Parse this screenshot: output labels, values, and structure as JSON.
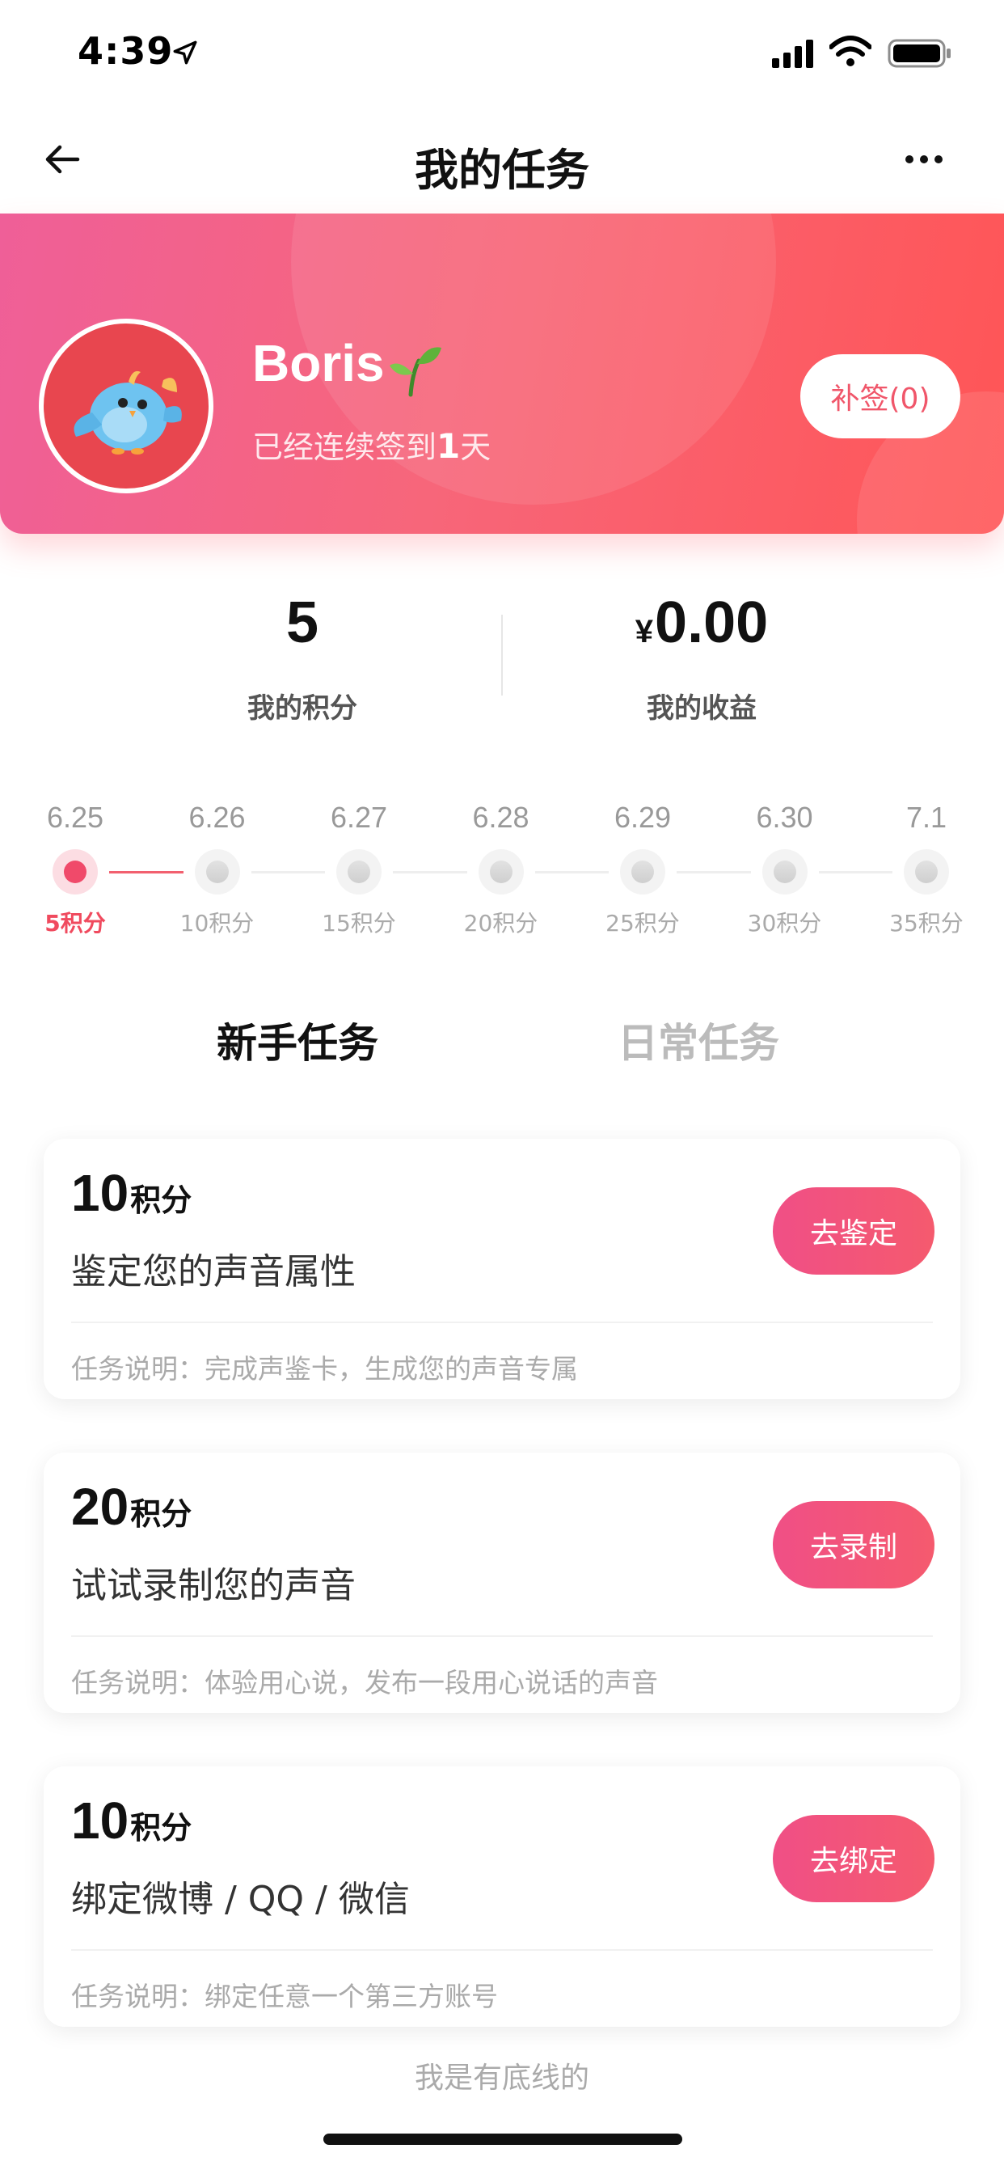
{
  "status_bar": {
    "time": "4:39"
  },
  "nav": {
    "title": "我的任务"
  },
  "profile": {
    "name": "Boris",
    "checkin_prefix": "已经连续签到",
    "checkin_days": "1",
    "checkin_suffix": "天",
    "makeup_label": "补签(0)"
  },
  "stats": {
    "points_value": "5",
    "points_label": "我的积分",
    "currency_symbol": "¥",
    "earnings_value": "0.00",
    "earnings_label": "我的收益"
  },
  "checkin_timeline": [
    {
      "date": "6.25",
      "points": "5积分",
      "active": true
    },
    {
      "date": "6.26",
      "points": "10积分",
      "active": false
    },
    {
      "date": "6.27",
      "points": "15积分",
      "active": false
    },
    {
      "date": "6.28",
      "points": "20积分",
      "active": false
    },
    {
      "date": "6.29",
      "points": "25积分",
      "active": false
    },
    {
      "date": "6.30",
      "points": "30积分",
      "active": false
    },
    {
      "date": "7.1",
      "points": "35积分",
      "active": false
    }
  ],
  "tabs": [
    {
      "label": "新手任务",
      "active": true
    },
    {
      "label": "日常任务",
      "active": false
    }
  ],
  "tasks": [
    {
      "points": "10",
      "unit": "积分",
      "title": "鉴定您的声音属性",
      "button": "去鉴定",
      "desc": "任务说明：完成声鉴卡，生成您的声音专属"
    },
    {
      "points": "20",
      "unit": "积分",
      "title": "试试录制您的声音",
      "button": "去录制",
      "desc": "任务说明：体验用心说，发布一段用心说话的声音"
    },
    {
      "points": "10",
      "unit": "积分",
      "title": "绑定微博 / QQ / 微信",
      "button": "去绑定",
      "desc": "任务说明：绑定任意一个第三方账号"
    }
  ],
  "footer": {
    "text": "我是有底线的"
  },
  "colors": {
    "accent": "#f04a6a",
    "banner_start": "#ef5f98",
    "banner_end": "#ff5556"
  }
}
